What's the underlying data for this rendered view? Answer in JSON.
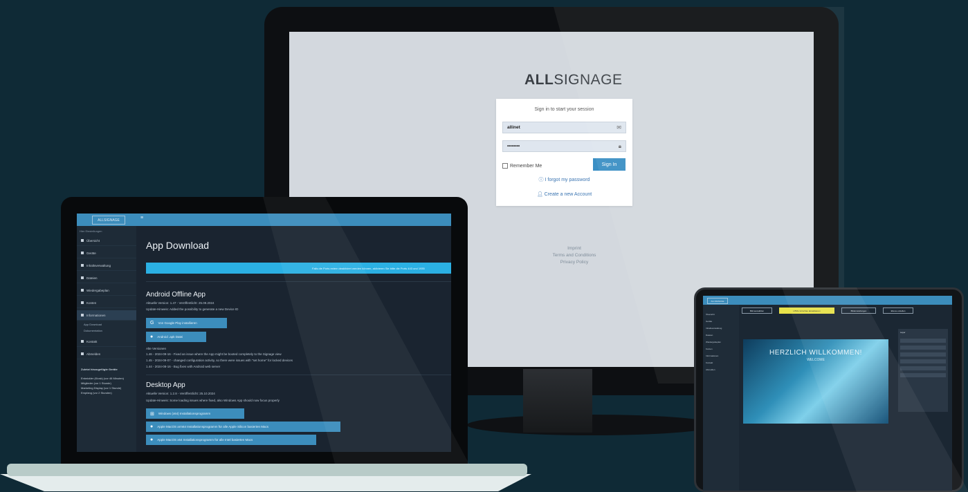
{
  "colors": {
    "background": "#0f2a36",
    "accent": "#3c8dbc",
    "alert": "#2bb0e3"
  },
  "monitor": {
    "brand_bold": "ALL",
    "brand_rest": "SIGNAGE",
    "login": {
      "title": "Sign in to start your session",
      "username_value": "allinet",
      "username_icon": "envelope-icon",
      "password_value": "••••••••",
      "password_icon": "lock-icon",
      "remember_label": "Remember Me",
      "signin_label": "Sign In",
      "forgot_label": "I forgot my password",
      "create_label": "Create a new Account"
    },
    "footer": [
      "Imprint",
      "Terms and Conditions",
      "Privacy Policy"
    ]
  },
  "laptop": {
    "logo": "ALLSIGNAGE",
    "menu_icon": "≡",
    "sidebar": {
      "header": "Hier Einstellungen",
      "items": [
        {
          "label": "Übersicht",
          "active": false
        },
        {
          "label": "Geräte",
          "active": false
        },
        {
          "label": "Inhaltsverwaltung",
          "active": false
        },
        {
          "label": "Dateien",
          "active": false
        },
        {
          "label": "Wiedergabeplan",
          "active": false
        },
        {
          "label": "Konten",
          "active": false
        },
        {
          "label": "Informationen",
          "active": true
        }
      ],
      "subitems": [
        "App Download",
        "Dokumentation"
      ],
      "items2": [
        {
          "label": "Kontakt"
        },
        {
          "label": "Abmelden"
        }
      ],
      "stats_title": "Zuletzt hinzugefügte Geräte",
      "stats": [
        "Entwickler (Kiosk) (vor 46 Minuten)",
        "Mitglieder (vor 1 Stunde)",
        "Marketing Display (vor 1 Stunde)",
        "Empfang (vor 2 Stunden)"
      ]
    },
    "page_title": "App Download",
    "alert_text": "Falls die Ports extern deaktiviert werden können, aktivieren Sie bitte die Ports 443 und 1935",
    "android": {
      "title": "Android Offline App",
      "version": "Aktuelle Version: 1.47 - Veröffentlicht: 25.09.2024",
      "update_note": "Update-Hinweis: Added the possibility to generate a new Device ID",
      "btn_play": "Von Google Play installieren",
      "btn_apk": "Android .apk Datei",
      "old_versions_title": "Alte Versionen",
      "old_versions": [
        "1.46 - 2024-09-16 - Fixed an issue where the App might be booted completely to the Signage view",
        "1.45 - 2024-09-07 - changed configuration activity, so there were issues with \"set home\" for locked devices",
        "1.44 - 2024-08-16 - Bug fixes with Android web server"
      ]
    },
    "desktop": {
      "title": "Desktop App",
      "version": "Aktuelle Version: 1.2.8 - Veröffentlicht: 25.10.2024",
      "update_note": "Update-Hinweis: Some loading issues where fixed, also Windows App should now focus properly",
      "btn_windows": "Windows (x64) Installationsprogramm",
      "btn_mac_arm": "Apple MacOS arm64 Installationsprogramm für alle Apple Silicon basierten Macs",
      "btn_mac_x64": "Apple MacOS x64 Installationsprogramm für alle Intel basierten Macs"
    }
  },
  "tablet": {
    "logo": "ALLSIGNAGE",
    "toolbar": [
      "Bild auswählen",
      "HTML-Vorschau aktualisieren",
      "Bildeinstellungen",
      "Ebene erstellen"
    ],
    "side_items": [
      "Übersicht",
      "Geräte",
      "Inhaltsverwaltung",
      "Dateien",
      "Wiedergabeplan",
      "Konten",
      "Informationen",
      "Kontakt",
      "Abmelden"
    ],
    "canvas_title": "HERZLICH WILLKOMMEN!",
    "canvas_sub": "WELCOME",
    "panel_title": "Layer"
  }
}
